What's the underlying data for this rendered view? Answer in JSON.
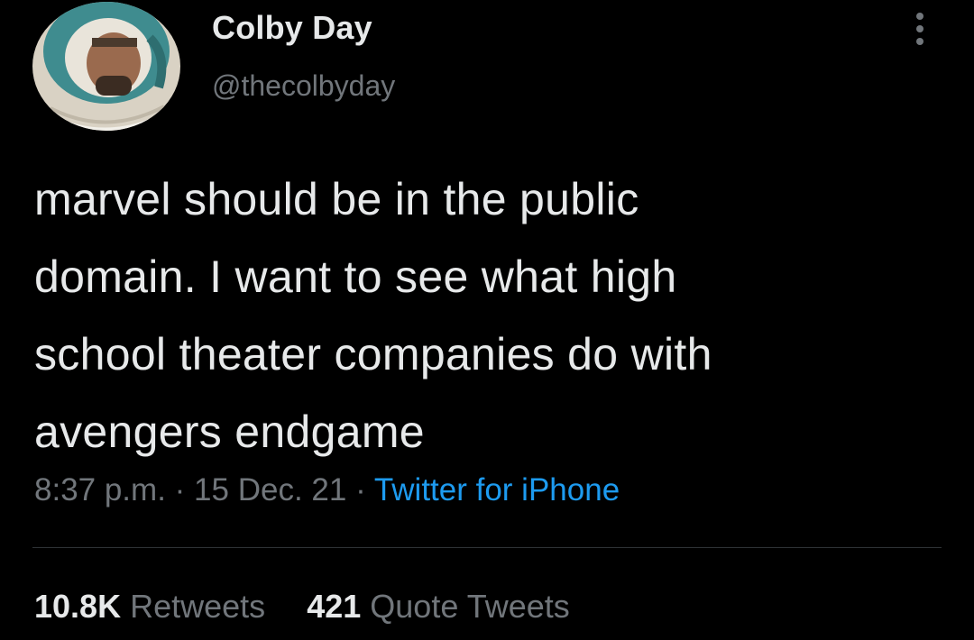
{
  "author": {
    "name": "Colby Day",
    "handle": "@thecolbyday"
  },
  "tweet": {
    "text": "marvel should be in the public\ndomain. I want to see what high\nschool theater companies do with\navengers endgame",
    "time": "8:37 p.m.",
    "separator": "·",
    "date": "15 Dec. 21",
    "source": "Twitter for iPhone"
  },
  "stats": {
    "retweets_count": "10.8K",
    "retweets_label": "Retweets",
    "quotes_count": "421",
    "quotes_label": "Quote Tweets"
  },
  "icons": {
    "more": "more-options-icon"
  },
  "colors": {
    "background": "#000000",
    "primary_text": "#E7E9EA",
    "secondary_text": "#71767B",
    "accent": "#1D9BF0",
    "divider": "#2F3336"
  }
}
